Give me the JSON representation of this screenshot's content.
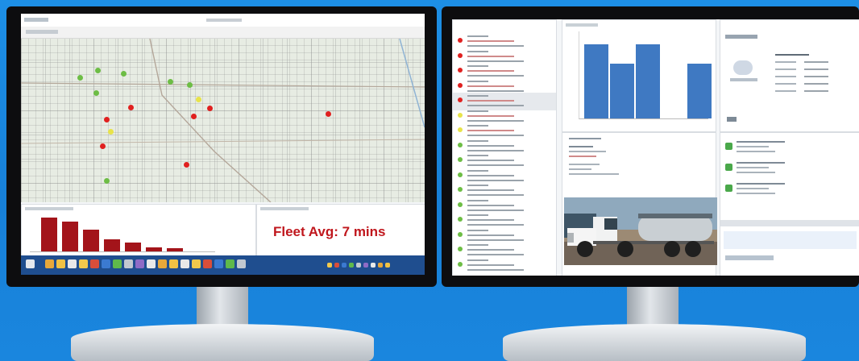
{
  "left_monitor": {
    "fleet_average": "Fleet Avg: 7 mins",
    "pins": [
      {
        "color": "green"
      },
      {
        "color": "green"
      },
      {
        "color": "green"
      },
      {
        "color": "green"
      },
      {
        "color": "green"
      },
      {
        "color": "yellow"
      },
      {
        "color": "red"
      },
      {
        "color": "red"
      },
      {
        "color": "red"
      },
      {
        "color": "red"
      },
      {
        "color": "yellow"
      },
      {
        "color": "red"
      },
      {
        "color": "red"
      },
      {
        "color": "green"
      },
      {
        "color": "green"
      },
      {
        "color": "red"
      }
    ],
    "mini_bar_values": [
      100,
      88,
      64,
      36,
      26,
      12,
      10
    ]
  },
  "right_monitor": {
    "list_dots": [
      "red",
      "red",
      "red",
      "red",
      "red",
      "yellow",
      "yellow",
      "green",
      "green",
      "green",
      "green",
      "green",
      "green",
      "green",
      "green",
      "green"
    ],
    "blue_bars": [
      92,
      68,
      92,
      0,
      68
    ],
    "contact_icons": 3
  },
  "colors": {
    "background": "#1a86de",
    "fleet_text": "#c0171d",
    "pin_green": "#6dbd45",
    "pin_red": "#e0201f",
    "pin_yellow": "#e8e34a",
    "bar_blue": "#3f79c2",
    "bar_red": "#a3141a"
  }
}
